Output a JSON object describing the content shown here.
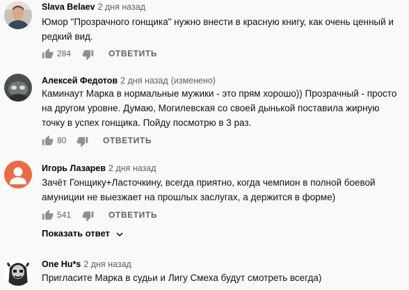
{
  "comments": [
    {
      "author": "Slava Belaev",
      "time": "2 дня назад",
      "edited": "",
      "lines": [
        "Юмор \"Прозрачного гонщика\" нужно внести в красную книгу, как очень ценный и",
        "редкий вид."
      ],
      "likes": "284",
      "reply_label": "ОТВЕТИТЬ"
    },
    {
      "author": "Алексей Федотов",
      "time": "2 дня назад",
      "edited": "(изменено)",
      "lines": [
        "Каминаут Марка в нормальные мужики - это прям хорошо)) Прозрачный - просто",
        "на другом уровне. Думаю, Могилевская со своей дынькой поставила жирную",
        "точку в успех гонщика. Пойду посмотрю в 3 раз."
      ],
      "likes": "80",
      "reply_label": "ОТВЕТИТЬ"
    },
    {
      "author": "Игорь Лазарев",
      "time": "2 дня назад",
      "edited": "",
      "lines": [
        "Зачёт Гонщику+Ласточкину, всегда приятно, когда чемпион в полной боевой",
        "амуниции не выезжает на прошлых заслугах, а держится в форме)"
      ],
      "likes": "541",
      "reply_label": "ОТВЕТИТЬ",
      "show_replies": "Показать ответ"
    },
    {
      "author": "One Hu*s",
      "time": "2 дня назад",
      "edited": "",
      "lines": [
        "Пригласите Марка в судьи и Лигу Смеха будут смотреть всегда)"
      ]
    }
  ],
  "icons": {
    "like": "thumb-up-icon",
    "dislike": "thumb-down-icon",
    "expand": "chevron-down-icon"
  },
  "colors": {
    "background": "#f9f9f9",
    "text": "#030303",
    "secondary": "#606060",
    "icon": "#909090",
    "avatar_igor": "#ec6b44"
  }
}
